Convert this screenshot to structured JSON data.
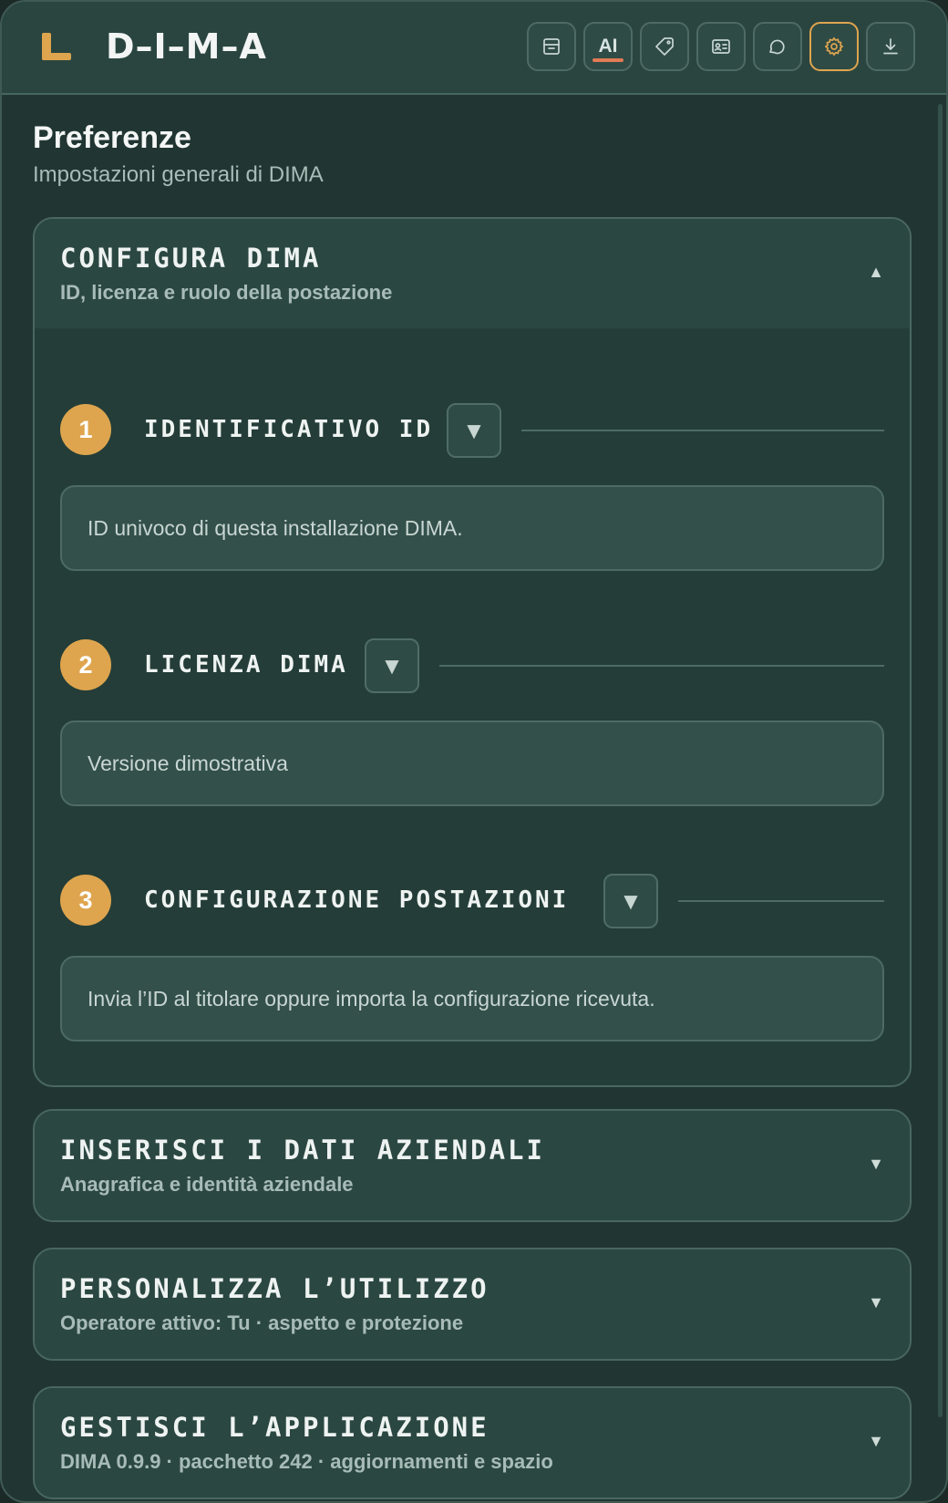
{
  "header": {
    "app_title": "D–I–M–A",
    "toolbar": [
      {
        "icon": "archive-icon"
      },
      {
        "icon": "ai-icon",
        "label": "AI"
      },
      {
        "icon": "tag-icon"
      },
      {
        "icon": "id-card-icon"
      },
      {
        "icon": "chat-bubble-icon"
      },
      {
        "icon": "gear-icon",
        "active": true
      },
      {
        "icon": "download-icon"
      }
    ]
  },
  "page": {
    "title": "Preferenze",
    "subtitle": "Impostazioni generali di DIMA"
  },
  "sections": [
    {
      "title": "CONFIGURA DIMA",
      "subtitle": "ID, licenza e ruolo della postazione",
      "toggle": "▲",
      "expanded": true,
      "steps": [
        {
          "number": "1",
          "title": "IDENTIFICATIVO ID",
          "toggle": "▼",
          "text": "ID univoco di questa installazione DIMA."
        },
        {
          "number": "2",
          "title": "LICENZA DIMA",
          "toggle": "▼",
          "text": "Versione dimostrativa"
        },
        {
          "number": "3",
          "title": "CONFIGURAZIONE POSTAZIONI",
          "toggle": "▼",
          "text": "Invia l’ID al titolare oppure importa la configurazione ricevuta."
        }
      ]
    },
    {
      "title": "INSERISCI I DATI AZIENDALI",
      "subtitle": "Anagrafica e identità aziendale",
      "toggle": "▼"
    },
    {
      "title": "PERSONALIZZA L’UTILIZZO",
      "subtitle": "Operatore attivo: Tu · aspetto e protezione",
      "toggle": "▼"
    },
    {
      "title": "GESTISCI L’APPLICAZIONE",
      "subtitle": "DIMA 0.9.9 · pacchetto 242 · aggiornamenti e spazio",
      "toggle": "▼"
    }
  ],
  "colors": {
    "accent": "#dea54e",
    "ai_underline": "#e17b55",
    "background": "#213632"
  }
}
